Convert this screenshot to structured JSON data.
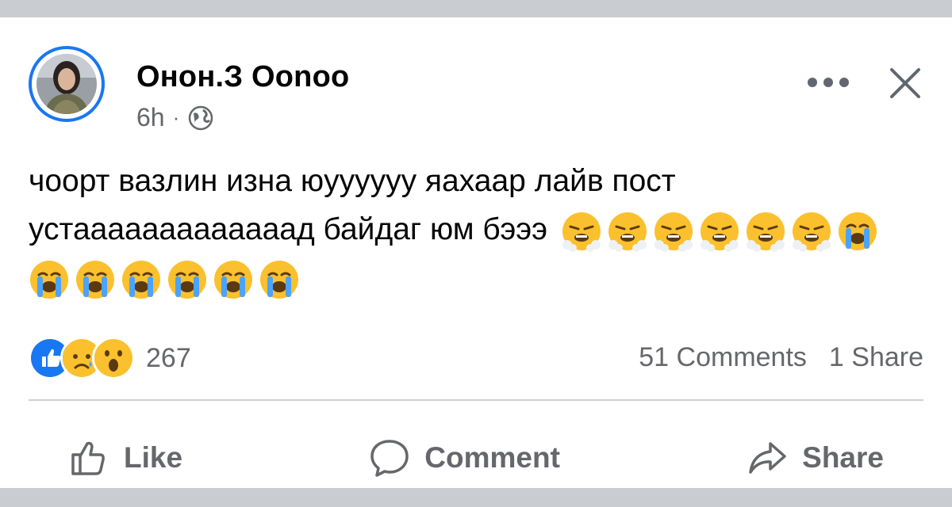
{
  "post": {
    "author": "Онон.З Оonoo",
    "time": "6h",
    "separator": "·",
    "privacy_icon": "globe-icon",
    "text_line1": "чоорт вазлин изна юуууууу яахаар лайв пост",
    "text_line2": "устааааааааааааад байдаг юм бэээ",
    "emojis_line2": [
      "triumph-face",
      "triumph-face",
      "triumph-face",
      "triumph-face",
      "triumph-face",
      "triumph-face",
      "crying-face"
    ],
    "emojis_line3": [
      "crying-face",
      "crying-face",
      "crying-face",
      "crying-face",
      "crying-face",
      "crying-face"
    ]
  },
  "stats": {
    "reaction_icons": [
      "like-icon",
      "sad-icon",
      "wow-icon"
    ],
    "reaction_count": "267",
    "comments": "51 Comments",
    "shares": "1 Share"
  },
  "actions": {
    "like": "Like",
    "comment": "Comment",
    "share": "Share"
  },
  "colors": {
    "accent": "#1877f2",
    "secondary_text": "#65676b",
    "stripe": "#c9ccd1",
    "emoji_yellow": "#fbc02d"
  }
}
